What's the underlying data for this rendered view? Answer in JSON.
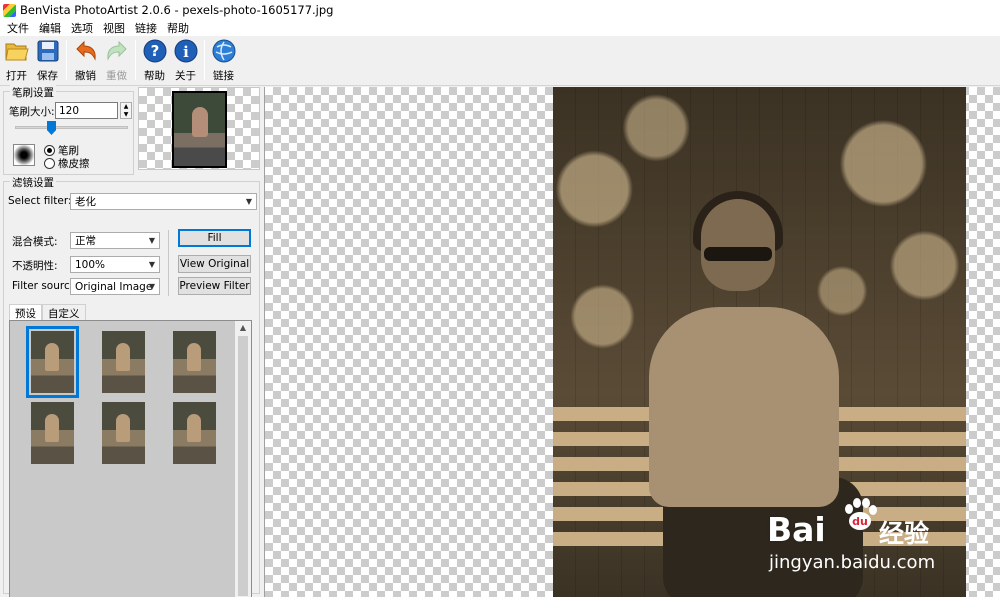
{
  "window": {
    "title": "BenVista PhotoArtist 2.0.6 - pexels-photo-1605177.jpg"
  },
  "menu": [
    "文件",
    "编辑",
    "选项",
    "视图",
    "链接",
    "帮助"
  ],
  "toolbar": {
    "open": "打开",
    "save": "保存",
    "undo": "撤销",
    "redo": "重做",
    "help": "帮助",
    "about": "关于",
    "link": "链接"
  },
  "brush": {
    "group_title": "笔刷设置",
    "size_label": "笔刷大小:",
    "size_value": "120",
    "mode_brush": "笔刷",
    "mode_eraser": "橡皮擦",
    "selected_mode": "brush"
  },
  "filter": {
    "group_title": "滤镜设置",
    "select_label": "Select filter:",
    "select_value": "老化",
    "blend_label": "混合模式:",
    "blend_value": "正常",
    "opacity_label": "不透明性:",
    "opacity_value": "100%",
    "source_label": "Filter source:",
    "source_value": "Original Image",
    "fill_button": "Fill",
    "view_original_button": "View Original",
    "preview_filter_button": "Preview Filter"
  },
  "tabs": {
    "preset": "预设",
    "custom": "自定义"
  },
  "presets": {
    "count": 6,
    "selected_index": 0
  },
  "watermark": {
    "brand": "Bai",
    "brand_suffix": "经验",
    "url": "jingyan.baidu.com"
  },
  "colors": {
    "accent": "#0078d7",
    "sepia": "#c8ad85"
  }
}
